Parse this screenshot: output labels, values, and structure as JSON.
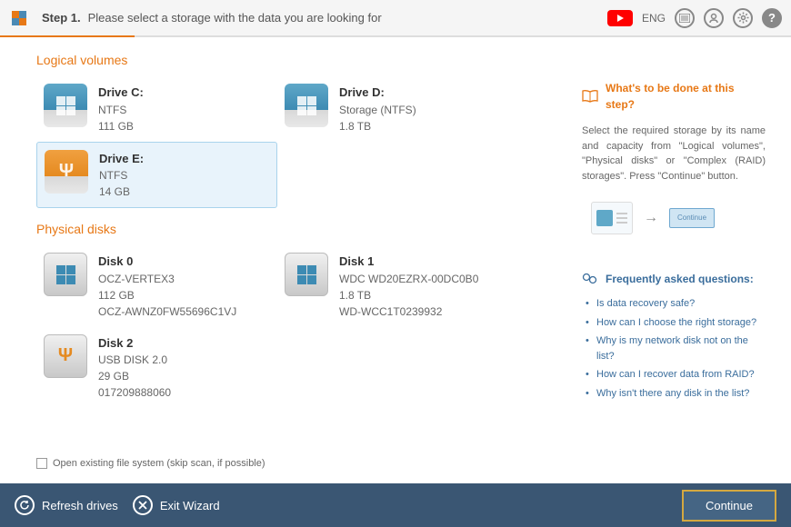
{
  "header": {
    "step_label": "Step 1.",
    "step_desc": "Please select a storage with the data you are looking for",
    "lang": "ENG"
  },
  "sections": {
    "logical_volumes": "Logical volumes",
    "physical_disks": "Physical disks"
  },
  "logical_volumes": [
    {
      "name": "Drive C:",
      "fs": "NTFS",
      "size": "111 GB",
      "selected": false,
      "iconType": "windows-blue"
    },
    {
      "name": "Drive D:",
      "fs": "Storage (NTFS)",
      "size": "1.8 TB",
      "selected": false,
      "iconType": "windows-blue"
    },
    {
      "name": "Drive E:",
      "fs": "NTFS",
      "size": "14 GB",
      "selected": true,
      "iconType": "usb-orange"
    }
  ],
  "physical_disks": [
    {
      "name": "Disk 0",
      "model": "OCZ-VERTEX3",
      "size": "112 GB",
      "serial": "OCZ-AWNZ0FW55696C1VJ",
      "iconType": "windows-gray"
    },
    {
      "name": "Disk 1",
      "model": "WDC WD20EZRX-00DC0B0",
      "size": "1.8 TB",
      "serial": "WD-WCC1T0239932",
      "iconType": "windows-gray"
    },
    {
      "name": "Disk 2",
      "model": "USB DISK 2.0",
      "size": "29 GB",
      "serial": "017209888060",
      "iconType": "usb-gray"
    }
  ],
  "checkbox": {
    "label": "Open existing file system (skip scan, if possible)"
  },
  "help": {
    "title": "What's to be done at this step?",
    "desc": "Select the required storage by its name and capacity from \"Logical volumes\", \"Physical disks\" or \"Complex (RAID) storages\". Press \"Continue\" button.",
    "illust_continue": "Continue"
  },
  "faq": {
    "title": "Frequently asked questions:",
    "items": [
      "Is data recovery safe?",
      "How can I choose the right storage?",
      "Why is my network disk not on the list?",
      "How can I recover data from RAID?",
      "Why isn't there any disk in the list?"
    ]
  },
  "footer": {
    "refresh": "Refresh drives",
    "exit": "Exit Wizard",
    "continue": "Continue"
  }
}
